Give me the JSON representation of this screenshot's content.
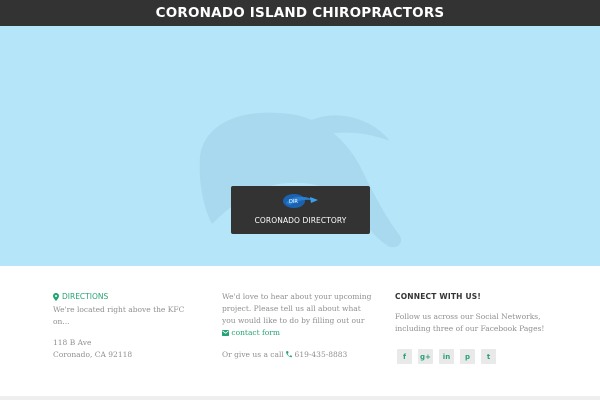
{
  "header": {
    "title": "CORONADO ISLAND CHIROPRACTORS"
  },
  "map": {
    "card_label": "CORONADO DIRECTORY",
    "logo_icon": "coronado-directory-logo"
  },
  "footer": {
    "col1": {
      "directions_label": "DIRECTIONS",
      "description": "We're located right above the KFC on...",
      "address_line1": "118 B Ave",
      "address_line2": "Coronado, CA 92118"
    },
    "col2": {
      "text_before_link": "We'd love to hear about your upcoming project. Please tell us all about what you would like to do by filling out our",
      "contact_link": "contact form",
      "call_text": "Or give us a call",
      "phone": "619-435-8883"
    },
    "col3": {
      "heading": "CONNECT WITH US!",
      "text": "Follow us across our Social Networks, including three of our Facebook Pages!",
      "socials": [
        {
          "icon": "facebook-icon",
          "glyph": "f"
        },
        {
          "icon": "google-plus-icon",
          "glyph": "g+"
        },
        {
          "icon": "linkedin-icon",
          "glyph": "in"
        },
        {
          "icon": "pinterest-icon",
          "glyph": "p"
        },
        {
          "icon": "twitter-icon",
          "glyph": "t"
        }
      ]
    }
  },
  "colors": {
    "header_bg": "#333333",
    "map_bg": "#b5e5f8",
    "accent_green": "#26a374",
    "muted_text": "#8f8f8f"
  }
}
